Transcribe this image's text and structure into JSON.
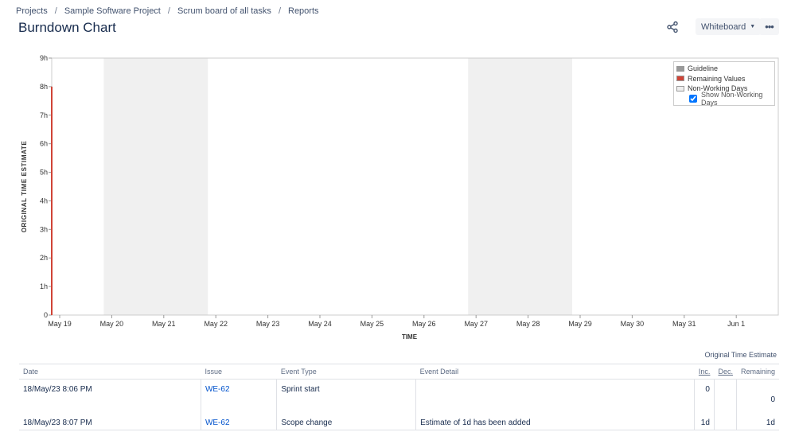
{
  "breadcrumb": [
    "Projects",
    "Sample Software Project",
    "Scrum board of all tasks",
    "Reports"
  ],
  "page_title": "Burndown Chart",
  "toolbar": {
    "board_label": "Whiteboard",
    "share_icon": "share-icon",
    "more_icon": "more-icon"
  },
  "chart_data": {
    "type": "line",
    "title": "",
    "xlabel": "TIME",
    "ylabel": "ORIGINAL TIME ESTIMATE",
    "x_ticks": [
      "May 19",
      "May 20",
      "May 21",
      "May 22",
      "May 23",
      "May 24",
      "May 25",
      "May 26",
      "May 27",
      "May 28",
      "May 29",
      "May 30",
      "May 31",
      "Jun 1"
    ],
    "y_ticks": [
      "0",
      "1h",
      "2h",
      "3h",
      "4h",
      "5h",
      "6h",
      "7h",
      "8h",
      "9h"
    ],
    "ylim": [
      0,
      9
    ],
    "non_working_days": [
      [
        "May 20",
        "May 22"
      ],
      [
        "May 27",
        "May 29"
      ]
    ],
    "series": [
      {
        "name": "Remaining Values",
        "color": "#d04437",
        "points": [
          {
            "x": "May 19",
            "y": 0
          },
          {
            "x": "May 19",
            "y": 8
          }
        ]
      },
      {
        "name": "Guideline",
        "color": "#999999",
        "points": []
      }
    ],
    "legend": {
      "position": "top-right",
      "items": [
        {
          "label": "Guideline",
          "color": "#999999"
        },
        {
          "label": "Remaining Values",
          "color": "#d04437"
        },
        {
          "label": "Non-Working Days",
          "color": "#eeeeee"
        }
      ],
      "checkbox_label": "Show Non-Working Days",
      "checkbox_checked": true
    },
    "grid": false
  },
  "table": {
    "group_header": "Original Time Estimate",
    "columns": [
      "Date",
      "Issue",
      "Event Type",
      "Event Detail",
      "Inc.",
      "Dec.",
      "Remaining"
    ],
    "rows": [
      {
        "date": "18/May/23 8:06 PM",
        "issue": "WE-62",
        "event_type": "Sprint start",
        "event_detail": "",
        "inc": "0",
        "dec": "",
        "remaining": "0"
      },
      {
        "date": "18/May/23 8:07 PM",
        "issue": "WE-62",
        "event_type": "Scope change",
        "event_detail": "Estimate of 1d has been added",
        "inc": "1d",
        "dec": "",
        "remaining": "1d"
      }
    ]
  }
}
